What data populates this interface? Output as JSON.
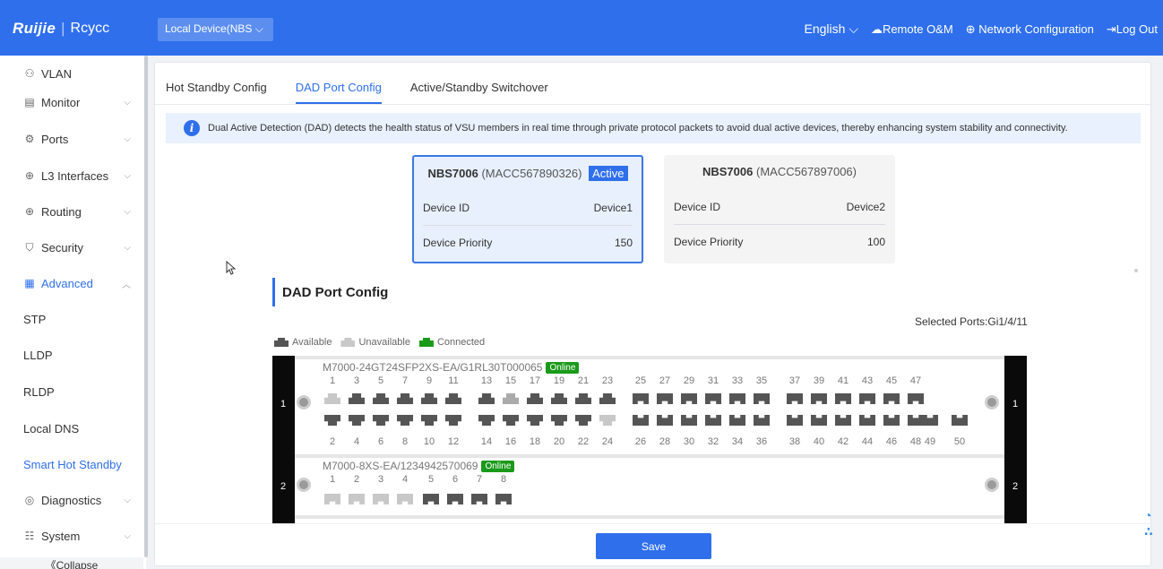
{
  "header": {
    "logo_brand": "Ruijie",
    "logo_product": "Rcycc",
    "device_select": "Local Device(NBS",
    "language": "English",
    "remote_om": "Remote O&M",
    "network_config": "Network Configuration",
    "logout": "Log Out"
  },
  "sidebar": {
    "items": [
      {
        "label": "VLAN",
        "icon": "vlan-icon",
        "expandable": false
      },
      {
        "label": "Monitor",
        "icon": "monitor-icon",
        "expandable": true
      },
      {
        "label": "Ports",
        "icon": "ports-icon",
        "expandable": true
      },
      {
        "label": "L3 Interfaces",
        "icon": "globe-icon",
        "expandable": true
      },
      {
        "label": "Routing",
        "icon": "globe-icon",
        "expandable": true
      },
      {
        "label": "Security",
        "icon": "shield-icon",
        "expandable": true
      },
      {
        "label": "Advanced",
        "icon": "briefcase-icon",
        "expandable": true,
        "expanded": true
      },
      {
        "label": "STP",
        "sub": true
      },
      {
        "label": "LLDP",
        "sub": true
      },
      {
        "label": "RLDP",
        "sub": true
      },
      {
        "label": "Local DNS",
        "sub": true
      },
      {
        "label": "Smart Hot Standby",
        "sub": true,
        "selected": true
      },
      {
        "label": "Diagnostics",
        "icon": "diagnostics-icon",
        "expandable": true
      },
      {
        "label": "System",
        "icon": "system-icon",
        "expandable": true
      }
    ],
    "collapse": "《Collapse"
  },
  "tabs": [
    "Hot Standby Config",
    "DAD Port Config",
    "Active/Standby Switchover"
  ],
  "active_tab": 1,
  "info_text": "Dual Active Detection (DAD) detects the health status of VSU members in real time through private protocol packets to avoid dual active devices, thereby enhancing system stability and connectivity.",
  "devices": [
    {
      "model": "NBS7006",
      "mac": "(MACC567890326)",
      "badge": "Active",
      "id_label": "Device ID",
      "id_value": "Device1",
      "priority_label": "Device Priority",
      "priority_value": "150"
    },
    {
      "model": "NBS7006",
      "mac": "(MACC567897006)",
      "badge": "",
      "id_label": "Device ID",
      "id_value": "Device2",
      "priority_label": "Device Priority",
      "priority_value": "100"
    }
  ],
  "section_title": "DAD Port Config",
  "selected_ports": "Selected Ports:Gi1/4/11",
  "legend": [
    {
      "label": "Available",
      "color": "#555555"
    },
    {
      "label": "Unavailable",
      "color": "#c8c8c8"
    },
    {
      "label": "Connected",
      "color": "#1a9a1a"
    }
  ],
  "chassis": {
    "slot_numbers": [
      "1",
      "2"
    ],
    "slot1": {
      "label": "M7000-24GT24SFP2XS-EA/G1RL30T000065",
      "status": "Online",
      "top_numbers": [
        "1",
        "3",
        "5",
        "7",
        "9",
        "11",
        "13",
        "15",
        "17",
        "19",
        "21",
        "23",
        "25",
        "27",
        "29",
        "31",
        "33",
        "35",
        "37",
        "39",
        "41",
        "43",
        "45",
        "47"
      ],
      "bottom_numbers": [
        "2",
        "4",
        "6",
        "8",
        "10",
        "12",
        "14",
        "16",
        "18",
        "20",
        "22",
        "24",
        "26",
        "28",
        "30",
        "32",
        "34",
        "36",
        "38",
        "40",
        "42",
        "44",
        "46",
        "48",
        "49",
        "50"
      ],
      "top_states": [
        "unavailable",
        "available",
        "available",
        "available",
        "available",
        "available",
        "available",
        "selected",
        "available",
        "available",
        "available",
        "available",
        "available",
        "available",
        "available",
        "available",
        "available",
        "available",
        "available",
        "available",
        "available",
        "available",
        "available",
        "available"
      ],
      "bottom_states": [
        "available",
        "available",
        "available",
        "available",
        "available",
        "available",
        "available",
        "available",
        "available",
        "available",
        "available",
        "unavailable",
        "available",
        "available",
        "available",
        "available",
        "available",
        "available",
        "available",
        "available",
        "available",
        "available",
        "available",
        "available",
        "available",
        "available"
      ]
    },
    "slot2": {
      "label": "M7000-8XS-EA/1234942570069",
      "status": "Online",
      "numbers": [
        "1",
        "2",
        "3",
        "4",
        "5",
        "6",
        "7",
        "8"
      ],
      "states": [
        "unavailable",
        "unavailable",
        "unavailable",
        "unavailable",
        "available",
        "available",
        "available",
        "available"
      ]
    }
  },
  "save_button": "Save"
}
